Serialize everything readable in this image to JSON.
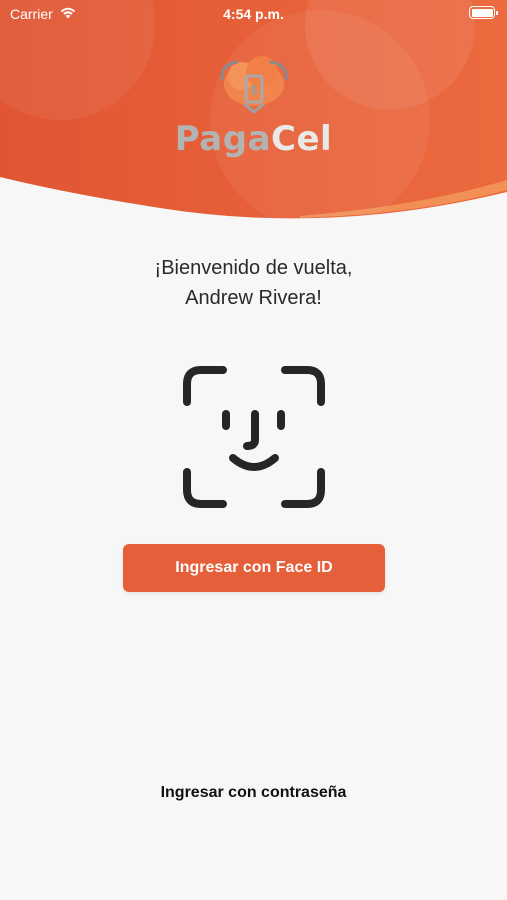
{
  "status_bar": {
    "carrier": "Carrier",
    "time": "4:54 p.m."
  },
  "logo": {
    "part1": "Paga",
    "part2": "Cel"
  },
  "welcome": {
    "line1": "¡Bienvenido de vuelta,",
    "line2": "Andrew Rivera!"
  },
  "face_id_button": {
    "label": "Ingresar con Face ID"
  },
  "password_link": {
    "label": "Ingresar con contraseña"
  },
  "colors": {
    "header_orange": "#e45f3a",
    "header_orange_light": "#f07a45",
    "button": "#e45f3a",
    "background": "#f7f7f7",
    "icon": "#262626"
  },
  "icons": {
    "wifi": "wifi-icon",
    "battery": "battery-icon",
    "logo": "cloud-phone-logo-icon",
    "face_id": "face-id-icon"
  }
}
